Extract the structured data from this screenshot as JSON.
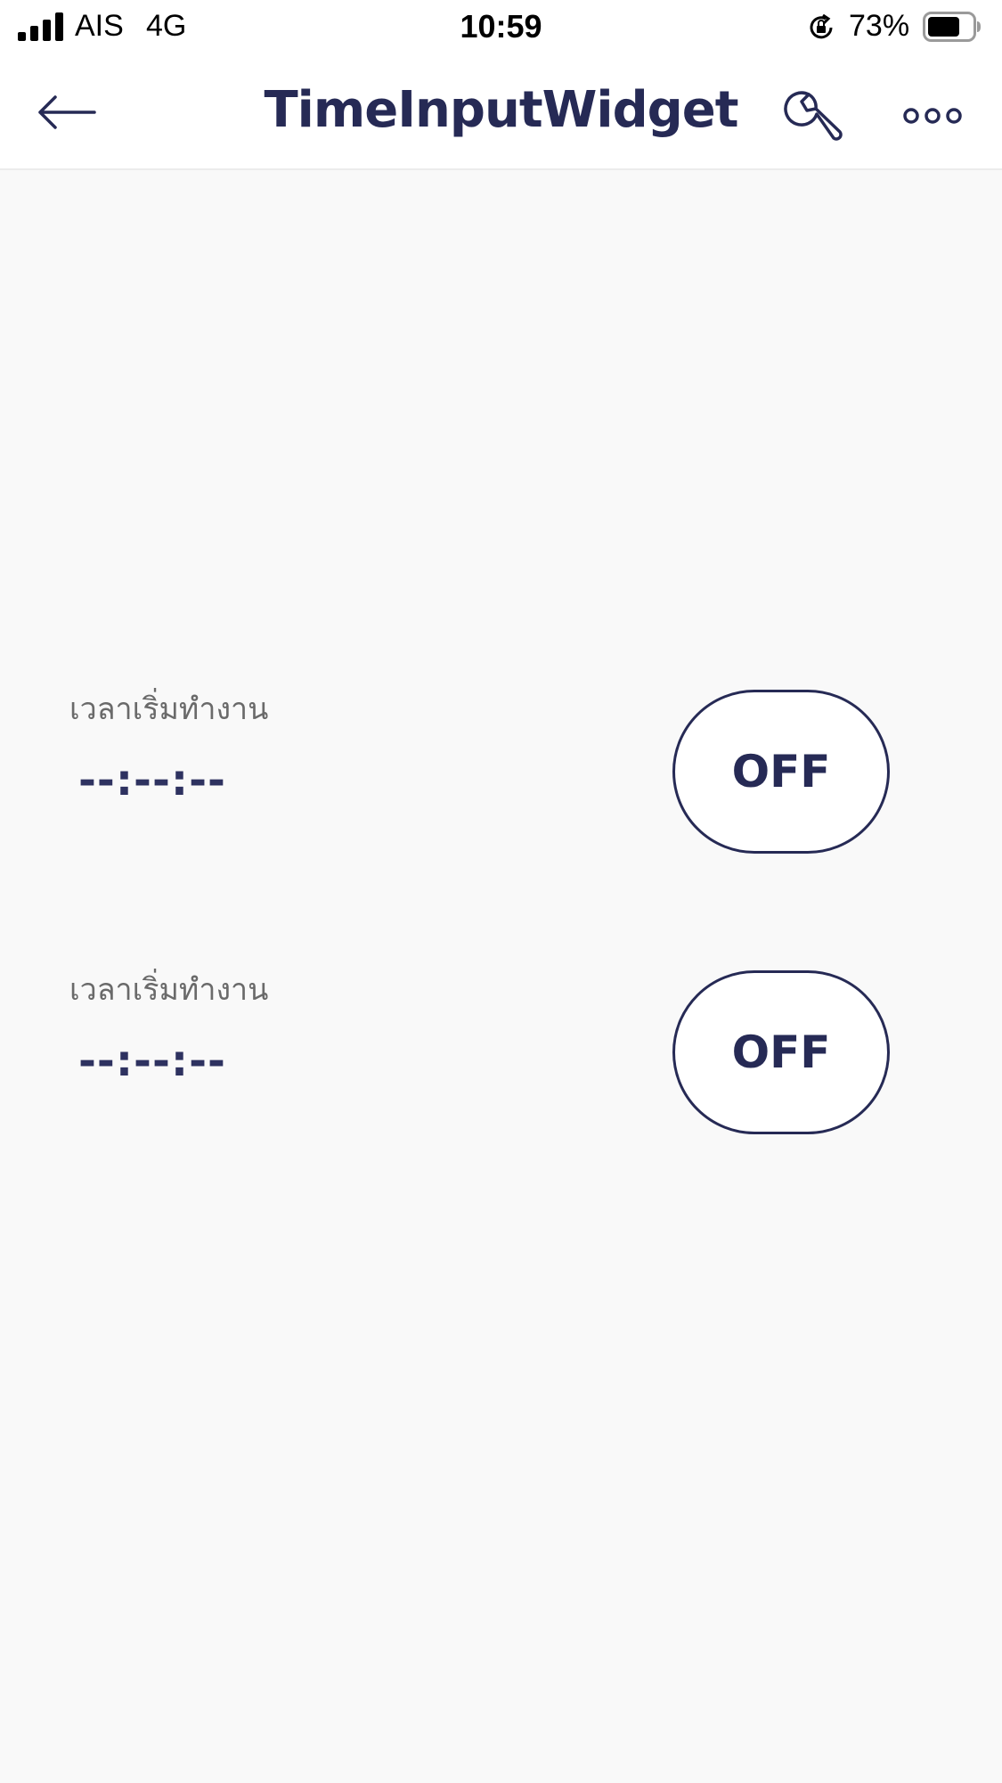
{
  "status_bar": {
    "carrier": "AIS",
    "network": "4G",
    "time": "10:59",
    "battery": "73%",
    "battery_level": 0.73
  },
  "header": {
    "title": "TimeInputWidget",
    "back_icon": "arrow-left-icon",
    "settings_icon": "wrench-icon",
    "more_icon": "more-dots-icon"
  },
  "widgets": [
    {
      "label": "เวลาเริ่มทำงาน",
      "value": "--:--:--",
      "button_label": "OFF"
    },
    {
      "label": "เวลาเริ่มทำงาน",
      "value": "--:--:--",
      "button_label": "OFF"
    }
  ],
  "colors": {
    "accent": "#262a55",
    "background": "#f9f9f9",
    "header_background": "#ffffff",
    "label_text": "#6a6a6a"
  }
}
